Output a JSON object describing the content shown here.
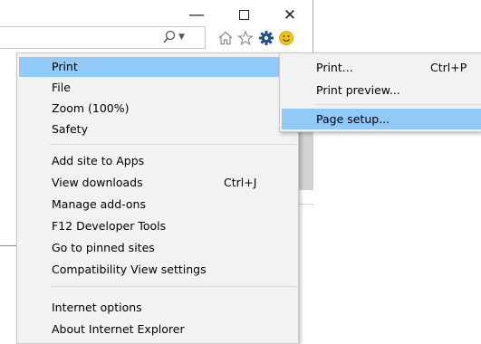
{
  "window": {
    "minimize_glyph": "—",
    "close_glyph": "✕"
  },
  "toolbar": {
    "icons": [
      "search-icon",
      "home-icon",
      "favorites-star-icon",
      "tools-gear-icon",
      "feedback-smiley-icon"
    ],
    "gear_color": "#1a4f8b",
    "smiley_color": "#f5c400"
  },
  "menu": {
    "items": [
      {
        "label": "Print",
        "has_submenu": true,
        "highlighted": true
      },
      {
        "label": "File",
        "has_submenu": true
      },
      {
        "label": "Zoom (100%)",
        "has_submenu": true
      },
      {
        "label": "Safety",
        "has_submenu": true
      },
      {
        "label": "Add site to Apps"
      },
      {
        "label": "View downloads",
        "shortcut": "Ctrl+J"
      },
      {
        "label": "Manage add-ons"
      },
      {
        "label": "F12 Developer Tools"
      },
      {
        "label": "Go to pinned sites"
      },
      {
        "label": "Compatibility View settings"
      },
      {
        "label": "Internet options"
      },
      {
        "label": "About Internet Explorer"
      }
    ],
    "submenu_arrow": "›"
  },
  "submenu": {
    "items": [
      {
        "label": "Print...",
        "shortcut": "Ctrl+P"
      },
      {
        "label": "Print preview..."
      },
      {
        "label": "Page setup...",
        "highlighted": true
      }
    ]
  },
  "colors": {
    "highlight": "#91c9f7",
    "menu_bg": "#f2f2f2"
  }
}
